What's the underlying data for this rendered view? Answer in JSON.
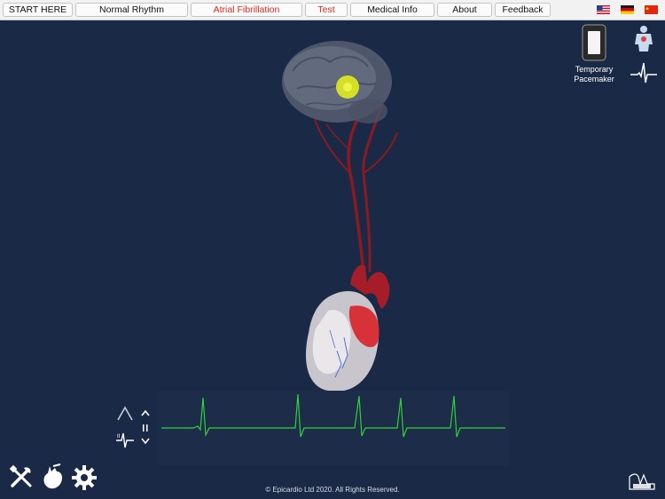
{
  "nav": {
    "tabs": [
      {
        "label": "START HERE",
        "active": false
      },
      {
        "label": "Normal Rhythm",
        "active": false
      },
      {
        "label": "Atrial Fibrillation",
        "active": true
      },
      {
        "label": "Test",
        "active": true
      },
      {
        "label": "Medical Info",
        "active": false
      },
      {
        "label": "About",
        "active": false
      },
      {
        "label": "Feedback",
        "active": false
      }
    ],
    "languages": [
      "us-flag-icon",
      "germany-flag-icon",
      "china-flag-icon"
    ]
  },
  "side_panel": {
    "pacemaker_label_line1": "Temporary",
    "pacemaker_label_line2": "Pacemaker",
    "icons": [
      "pacemaker-device-icon",
      "body-figure-icon",
      "ecg-waveform-icon"
    ]
  },
  "ecg_controls": {
    "icons": [
      "chevron-up-icon",
      "chevron-down-icon",
      "pause-icon",
      "angle-icon",
      "lead-icon"
    ]
  },
  "toolbar": {
    "icons": [
      "tools-icon",
      "heart-settings-icon",
      "gear-icon"
    ]
  },
  "logo_icon": "epicardio-logo-icon",
  "footer": {
    "copyright": "© Epicardio Ltd 2020. All Rights Reserved."
  },
  "colors": {
    "background": "#1a2a46",
    "active_tab_text": "#e0271d",
    "ecg_trace": "#2fd13a",
    "artery": "#8a1a22",
    "brain_marker": "#e6ee2a"
  }
}
